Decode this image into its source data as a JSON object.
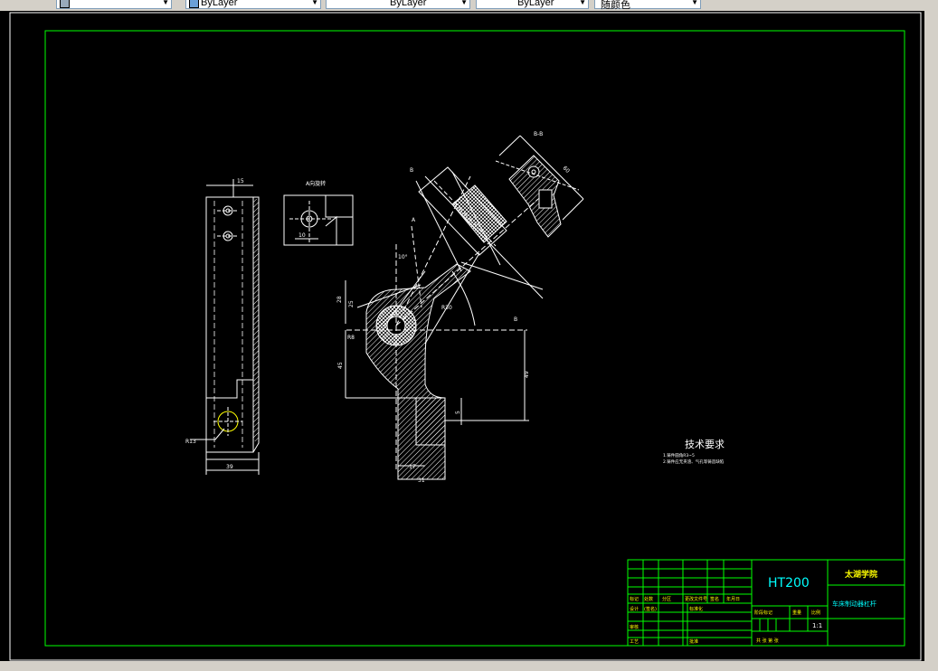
{
  "toolbar": {
    "combos": [
      {
        "name": "layer-combo",
        "text": ""
      },
      {
        "name": "color-combo",
        "text": "ByLayer"
      },
      {
        "name": "linetype-combo",
        "text": "ByLayer"
      },
      {
        "name": "lineweight-combo",
        "text": "ByLayer"
      },
      {
        "name": "plotstyle-combo",
        "text": "随颜色"
      }
    ]
  },
  "drawing": {
    "view_a_label": "A向旋转",
    "section_label": "B-B",
    "tech_title": "技术要求",
    "tech_line1": "1.铸件圆角R3~5",
    "tech_line2": "2.铸件应无夹渣、气孔等铸造缺陷",
    "dims": {
      "left_top": "15",
      "left_bottom": "39",
      "left_radius": "R13",
      "va_dim": "10",
      "mid_25": "25",
      "mid_28": "28",
      "mid_45": "45",
      "mid_r8": "R8",
      "mid_17": "17",
      "mid_31": "31",
      "mid_5": "5",
      "mid_49": "49",
      "mid_r30": "R30",
      "mid_10": "10°",
      "mid_a": "A",
      "mid_b": "B",
      "right_60": "60"
    }
  },
  "title_block": {
    "material": "HT200",
    "school": "太湖学院",
    "part_name": "车床制动器杠杆",
    "scale": "1:1",
    "rows": [
      [
        "标记",
        "处数",
        "分区",
        "更改文件号",
        "签名",
        "年月日"
      ],
      [
        "设计",
        "(签名)",
        "",
        "标准化",
        "",
        ""
      ],
      [
        "审核",
        "",
        "",
        "",
        "",
        ""
      ],
      [
        "工艺",
        "",
        "",
        "批准",
        "",
        ""
      ]
    ],
    "stage_label": "阶段标记",
    "weight_label": "重量",
    "scale_label": "比例",
    "sheet_label": "共 张  第 张"
  }
}
